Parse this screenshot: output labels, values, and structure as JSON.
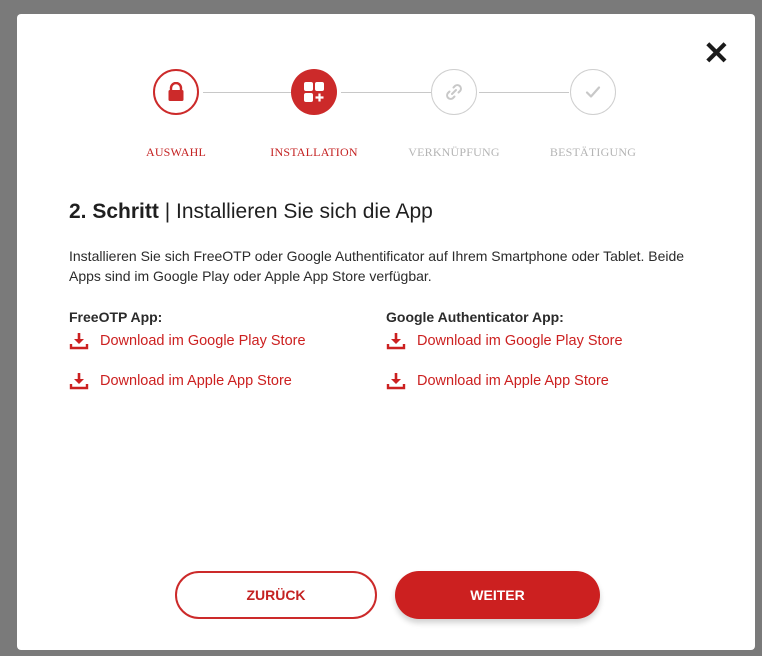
{
  "dialog": {
    "close_label": "✕"
  },
  "stepper": {
    "steps": [
      {
        "label": "AUSWAHL",
        "state": "completed",
        "icon": "lock-icon"
      },
      {
        "label": "INSTALLATION",
        "state": "active",
        "icon": "apps-icon"
      },
      {
        "label": "VERKNÜPFUNG",
        "state": "disabled",
        "icon": "link-icon"
      },
      {
        "label": "BESTÄTIGUNG",
        "state": "disabled",
        "icon": "check-icon"
      }
    ]
  },
  "content": {
    "step_number": "2. Schritt",
    "separator": " | ",
    "title": "Installieren Sie sich die App",
    "description": "Installieren Sie sich FreeOTP oder Google Authentificator auf Ihrem Smartphone oder Tablet. Beide Apps sind im Google Play oder Apple App Store verfügbar.",
    "columns": [
      {
        "title": "FreeOTP App:",
        "links": [
          "Download im Google Play Store",
          "Download im Apple App Store"
        ]
      },
      {
        "title": "Google Authenticator App:",
        "links": [
          "Download im Google Play Store",
          "Download im Apple App Store"
        ]
      }
    ]
  },
  "actions": {
    "back_label": "ZURÜCK",
    "next_label": "WEITER"
  },
  "colors": {
    "accent": "#cc2020",
    "disabled": "#c8c8c8",
    "overlay": "#7a7a7a"
  }
}
